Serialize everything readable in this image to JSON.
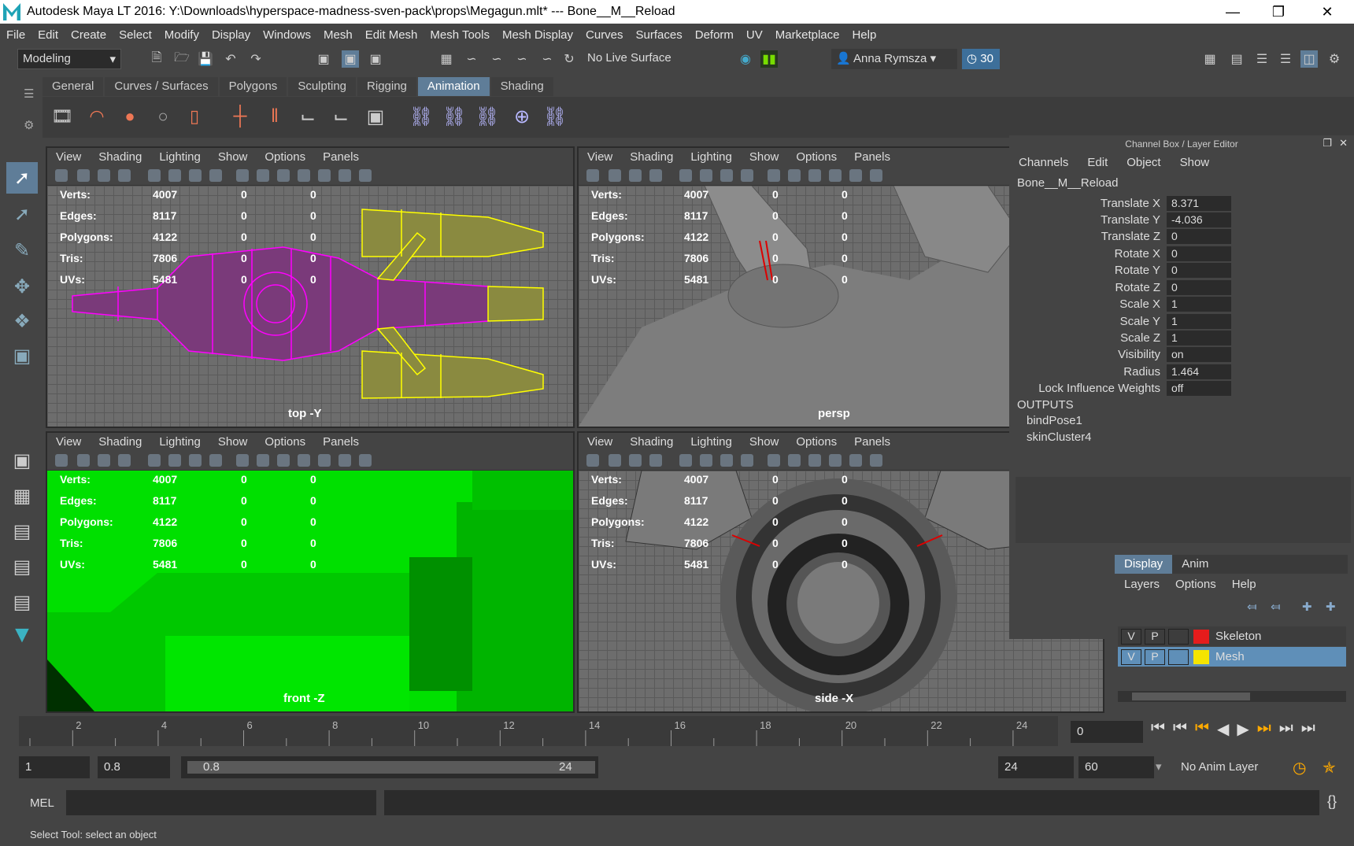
{
  "window": {
    "title": "Autodesk Maya LT 2016: Y:\\Downloads\\hyperspace-madness-sven-pack\\props\\Megagun.mlt*  ---  Bone__M__Reload"
  },
  "menubar": [
    "File",
    "Edit",
    "Create",
    "Select",
    "Modify",
    "Display",
    "Windows",
    "Mesh",
    "Edit Mesh",
    "Mesh Tools",
    "Mesh Display",
    "Curves",
    "Surfaces",
    "Deform",
    "UV",
    "Marketplace",
    "Help"
  ],
  "statusline": {
    "mode": "Modeling",
    "live_surface": "No Live Surface",
    "user": "Anna Rymsza",
    "trial_days": "30"
  },
  "shelf_tabs": [
    "General",
    "Curves / Surfaces",
    "Polygons",
    "Sculpting",
    "Rigging",
    "Animation",
    "Shading"
  ],
  "shelf_active": "Animation",
  "viewport_menu": [
    "View",
    "Shading",
    "Lighting",
    "Show",
    "Options",
    "Panels"
  ],
  "hud": {
    "labels": [
      "Verts:",
      "Edges:",
      "Polygons:",
      "Tris:",
      "UVs:"
    ],
    "values": [
      "4007",
      "8117",
      "4122",
      "7806",
      "5481"
    ],
    "zeros": "0"
  },
  "viewports": {
    "top": "top -Y",
    "persp": "persp",
    "front": "front -Z",
    "side": "side -X"
  },
  "channel_box": {
    "title": "Channel Box / Layer Editor",
    "menu": [
      "Channels",
      "Edit",
      "Object",
      "Show"
    ],
    "node": "Bone__M__Reload",
    "attrs": [
      {
        "name": "Translate X",
        "value": "8.371"
      },
      {
        "name": "Translate Y",
        "value": "-4.036"
      },
      {
        "name": "Translate Z",
        "value": "0"
      },
      {
        "name": "Rotate X",
        "value": "0"
      },
      {
        "name": "Rotate Y",
        "value": "0"
      },
      {
        "name": "Rotate Z",
        "value": "0"
      },
      {
        "name": "Scale X",
        "value": "1"
      },
      {
        "name": "Scale Y",
        "value": "1"
      },
      {
        "name": "Scale Z",
        "value": "1"
      },
      {
        "name": "Visibility",
        "value": "on"
      },
      {
        "name": "Radius",
        "value": "1.464"
      },
      {
        "name": "Lock Influence Weights",
        "value": "off"
      }
    ],
    "outputs_label": "OUTPUTS",
    "outputs": [
      "bindPose1",
      "skinCluster4"
    ]
  },
  "layer_editor": {
    "tabs": [
      "Display",
      "Anim"
    ],
    "menu": [
      "Layers",
      "Options",
      "Help"
    ],
    "layers": [
      {
        "v": "V",
        "p": "P",
        "name": "Skeleton",
        "color": "#e51c1c"
      },
      {
        "v": "V",
        "p": "P",
        "name": "Mesh",
        "color": "#f5e400"
      }
    ]
  },
  "timeline": {
    "ticks": [
      "2",
      "4",
      "6",
      "8",
      "10",
      "12",
      "14",
      "16",
      "18",
      "20",
      "22",
      "24"
    ],
    "current_frame": "0"
  },
  "range": {
    "start": "1",
    "anim_start": "0.8",
    "slider_start": "0.8",
    "slider_end": "24",
    "end": "24",
    "anim_end": "60",
    "anim_layer": "No Anim Layer"
  },
  "cmdline": {
    "label": "MEL"
  },
  "help_line": "Select Tool: select an object"
}
